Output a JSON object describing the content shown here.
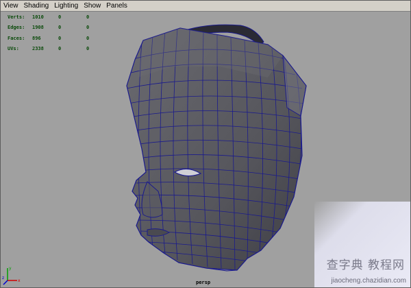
{
  "menu": {
    "items": [
      {
        "label": "View"
      },
      {
        "label": "Shading"
      },
      {
        "label": "Lighting"
      },
      {
        "label": "Show"
      },
      {
        "label": "Panels"
      }
    ]
  },
  "hud": {
    "rows": [
      {
        "label": "Verts:",
        "v1": "1010",
        "v2": "0",
        "v3": "0"
      },
      {
        "label": "Edges:",
        "v1": "1908",
        "v2": "0",
        "v3": "0"
      },
      {
        "label": "Faces:",
        "v1": "896",
        "v2": "0",
        "v3": "0"
      },
      {
        "label": "UVs:",
        "v1": "2338",
        "v2": "0",
        "v3": "0"
      }
    ]
  },
  "viewport": {
    "camera_label": "persp",
    "axis": {
      "x": "x",
      "y": "y",
      "z": "z"
    }
  },
  "watermark": {
    "title": "查字典 教程网",
    "url": "jiaocheng.chazidian.com"
  },
  "colors": {
    "background": "#a0a0a0",
    "mesh_face": "#5e5e62",
    "wireframe": "#1a1a8c",
    "hud_text": "#0a4a0a"
  }
}
